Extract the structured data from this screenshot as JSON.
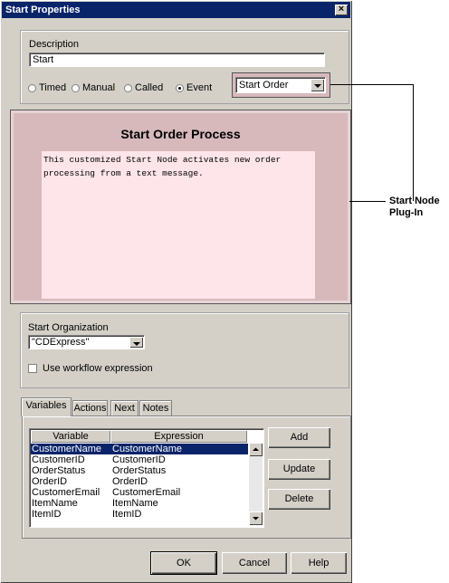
{
  "window": {
    "title": "Start Properties",
    "close_glyph": "×"
  },
  "description": {
    "label": "Description",
    "value": "Start"
  },
  "trigger": {
    "options": [
      {
        "label": "Timed",
        "selected": false
      },
      {
        "label": "Manual",
        "selected": false
      },
      {
        "label": "Called",
        "selected": false
      },
      {
        "label": "Event",
        "selected": true
      }
    ],
    "event_select": "Start Order"
  },
  "plugin": {
    "title": "Start Order Process",
    "text": "This customized Start Node activates new order processing from a text message."
  },
  "organization": {
    "label": "Start Organization",
    "select_value": "\"CDExpress\"",
    "checkbox_label": "Use workflow expression",
    "checked": false
  },
  "tabs": [
    {
      "label": "Variables",
      "active": true
    },
    {
      "label": "Actions",
      "active": false
    },
    {
      "label": "Next",
      "active": false
    },
    {
      "label": "Notes",
      "active": false
    }
  ],
  "variables_table": {
    "columns": [
      "Variable",
      "Expression"
    ],
    "rows": [
      {
        "variable": "CustomerName",
        "expression": "CustomerName",
        "selected": true
      },
      {
        "variable": "CustomerID",
        "expression": "CustomerID",
        "selected": false
      },
      {
        "variable": "OrderStatus",
        "expression": "OrderStatus",
        "selected": false
      },
      {
        "variable": "OrderID",
        "expression": "OrderID",
        "selected": false
      },
      {
        "variable": "CustomerEmail",
        "expression": "CustomerEmail",
        "selected": false
      },
      {
        "variable": "ItemName",
        "expression": "ItemName",
        "selected": false
      },
      {
        "variable": "ItemID",
        "expression": "ItemID",
        "selected": false
      }
    ]
  },
  "side_buttons": {
    "add": "Add",
    "update": "Update",
    "delete": "Delete"
  },
  "bottom_buttons": {
    "ok": "OK",
    "cancel": "Cancel",
    "help": "Help"
  },
  "annotation": {
    "line1": "Start Node",
    "line2": "Plug-In"
  },
  "colors": {
    "titlebar": "#0a246a",
    "dialog": "#d4d0c8",
    "plugin_bg": "#d7b9bc",
    "plugin_text_bg": "#fde5ea",
    "highlight": "#0a246a"
  }
}
